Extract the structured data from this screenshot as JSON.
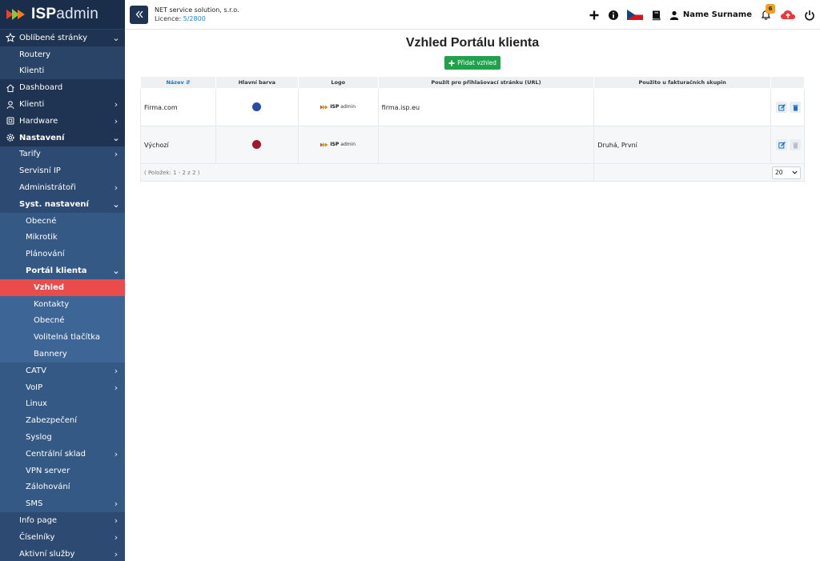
{
  "brand": {
    "name_bold": "ISP",
    "name_light": "admin"
  },
  "topbar": {
    "company": "NET service solution, s.r.o.",
    "licence_label": "Licence:",
    "licence_value": "5/2800",
    "user_name": "Name Surname",
    "notification_count": "6"
  },
  "sidebar": {
    "favorites": "Oblíbené stránky",
    "routers": "Routery",
    "clients_fav": "Klienti",
    "dashboard": "Dashboard",
    "clients": "Klienti",
    "hardware": "Hardware",
    "settings": "Nastavení",
    "tariffs": "Tarify",
    "service_ip": "Servisní IP",
    "admins": "Administrátoři",
    "sys_settings": "Syst. nastavení",
    "general": "Obecné",
    "mikrotik": "Mikrotik",
    "planning": "Plánování",
    "client_portal": "Portál klienta",
    "appearance": "Vzhled",
    "contacts": "Kontakty",
    "portal_general": "Obecné",
    "optional_buttons": "Volitelná tlačítka",
    "banners": "Bannery",
    "catv": "CATV",
    "voip": "VoIP",
    "linux": "Linux",
    "security": "Zabezpečení",
    "syslog": "Syslog",
    "central_storage": "Centrální sklad",
    "vpn_server": "VPN server",
    "backup": "Zálohování",
    "sms": "SMS",
    "info_page": "Info page",
    "codebooks": "Číselníky",
    "active_services": "Aktivní služby"
  },
  "main": {
    "title": "Vzhled Portálu klienta",
    "add_button": "Přidat vzhled",
    "columns": [
      "Název",
      "Hlavní barva",
      "Logo",
      "Použít pro přihlašovací stránku (URL)",
      "Použito u fakturačních skupin",
      ""
    ],
    "rows": [
      {
        "name": "Firma.com",
        "color": "#2a4aa8",
        "url": "firma.isp.eu",
        "groups": ""
      },
      {
        "name": "Výchozí",
        "color": "#a3162d",
        "url": "",
        "groups": "Druhá, První"
      }
    ],
    "footer": "( Položek: 1 - 2 z 2 )",
    "page_size": "20"
  },
  "colors": {
    "sidebar": "#1f3352",
    "accent_active": "#ea4b4b",
    "add_button": "#1fa24a",
    "link": "#1f6fc8"
  }
}
